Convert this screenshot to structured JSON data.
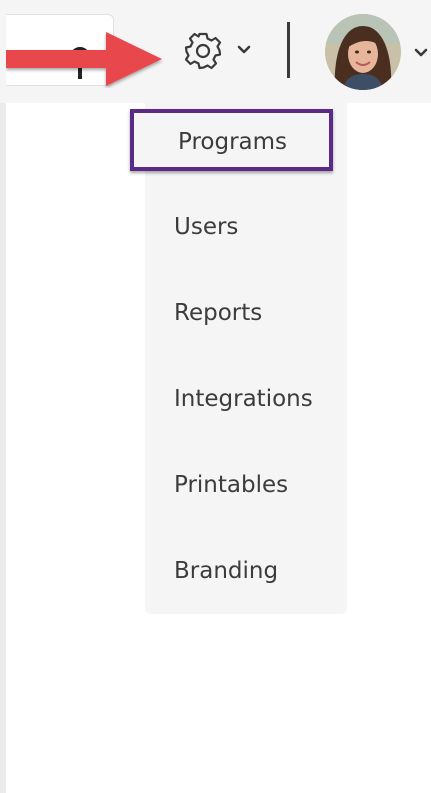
{
  "colors": {
    "annotation_arrow": "#e8474b",
    "highlight_border": "#5b2a86",
    "menu_background": "#f5f5f5",
    "menu_text": "#3c3c3c",
    "topbar_background": "#f5f5f5"
  },
  "header": {
    "search": {
      "icon": "search-icon"
    },
    "settings": {
      "icon": "gear-icon",
      "dropdown_icon": "chevron-down-icon"
    },
    "profile": {
      "icon": "avatar",
      "dropdown_icon": "chevron-down-icon"
    }
  },
  "annotation": {
    "icon": "arrow-right-icon",
    "highlighted_item": "Programs"
  },
  "settings_menu": {
    "items": [
      {
        "label": "Programs",
        "highlighted": true
      },
      {
        "label": "Users"
      },
      {
        "label": "Reports"
      },
      {
        "label": "Integrations"
      },
      {
        "label": "Printables"
      },
      {
        "label": "Branding"
      }
    ]
  }
}
